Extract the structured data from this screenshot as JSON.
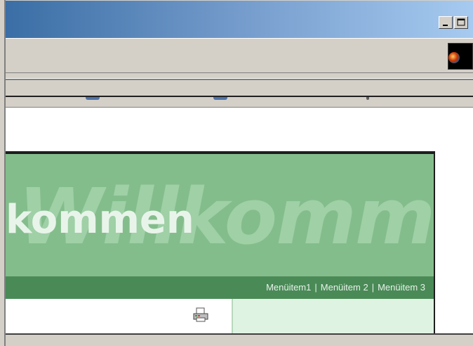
{
  "window": {
    "minimize_glyph": "_",
    "maximize_glyph": "□"
  },
  "banner": {
    "ghost_word": "Willkomm",
    "main_word": "kommen",
    "menu": [
      "Menüitem1",
      "Menüitem 2",
      "Menüitem 3"
    ],
    "separator": "|"
  },
  "icons": {
    "printer": "printer-icon",
    "browser_logo": "windows-logo-icon"
  },
  "colors": {
    "banner_green": "#84bd8c",
    "menu_green": "#4a8a57",
    "panel_green": "#dff3e3",
    "title_start": "#3a6ea5",
    "title_end": "#a6caf0"
  }
}
